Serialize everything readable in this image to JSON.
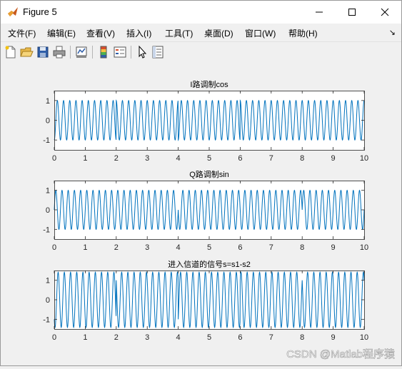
{
  "window": {
    "title": "Figure 5",
    "controls": {
      "minimize": "minimize",
      "maximize": "maximize",
      "close": "close"
    }
  },
  "menu": {
    "items": [
      "文件(F)",
      "编辑(E)",
      "查看(V)",
      "插入(I)",
      "工具(T)",
      "桌面(D)",
      "窗口(W)",
      "帮助(H)"
    ]
  },
  "toolbar": {
    "icons": [
      "new-figure-icon",
      "open-file-icon",
      "save-icon",
      "print-icon",
      "link-plot-icon",
      "insert-colorbar-icon",
      "insert-legend-icon",
      "edit-plot-icon",
      "property-inspector-icon"
    ]
  },
  "colors": {
    "line": "#0072bd",
    "axes": "#262626",
    "window_bg": "#f0f0f0"
  },
  "chart_data": [
    {
      "type": "line",
      "title": "I路调制cos",
      "xlabel": "",
      "ylabel": "",
      "xlim": [
        0,
        10
      ],
      "ylim": [
        -1.5,
        1.5
      ],
      "xticks": [
        "0",
        "1",
        "2",
        "3",
        "4",
        "5",
        "6",
        "7",
        "8",
        "9",
        "10"
      ],
      "yticks": [
        "1",
        "0",
        "-1"
      ],
      "grid": false,
      "series": [
        {
          "function": "bpsk_cos",
          "carrier_cycles_per_unit": 5,
          "amplitude": 1,
          "bit_duration": 2,
          "bits": [
            -1,
            1,
            -1,
            1,
            1
          ]
        }
      ]
    },
    {
      "type": "line",
      "title": "Q路调制sin",
      "xlabel": "",
      "ylabel": "",
      "xlim": [
        0,
        10
      ],
      "ylim": [
        -1.5,
        1.5
      ],
      "xticks": [
        "0",
        "1",
        "2",
        "3",
        "4",
        "5",
        "6",
        "7",
        "8",
        "9",
        "10"
      ],
      "yticks": [
        "1",
        "0",
        "-1"
      ],
      "grid": false,
      "series": [
        {
          "function": "bpsk_sin",
          "carrier_cycles_per_unit": 5,
          "amplitude": 1,
          "bit_duration": 2,
          "bits": [
            1,
            1,
            -1,
            -1,
            1
          ]
        }
      ]
    },
    {
      "type": "line",
      "title": "进入信道的信号s=s1-s2",
      "xlabel": "",
      "ylabel": "",
      "xlim": [
        0,
        10
      ],
      "ylim": [
        -1.5,
        1.5
      ],
      "xticks": [
        "0",
        "1",
        "2",
        "3",
        "4",
        "5",
        "6",
        "7",
        "8",
        "9",
        "10"
      ],
      "yticks": [
        "1",
        "0",
        "-1"
      ],
      "grid": false,
      "series": [
        {
          "function": "qpsk_sum",
          "carrier_cycles_per_unit": 5,
          "amplitude": 1.414,
          "bit_duration": 2,
          "bits_i": [
            -1,
            1,
            -1,
            1,
            1
          ],
          "bits_q": [
            1,
            1,
            -1,
            -1,
            1
          ]
        }
      ]
    }
  ],
  "watermark": "CSDN @Matlab程序猿"
}
